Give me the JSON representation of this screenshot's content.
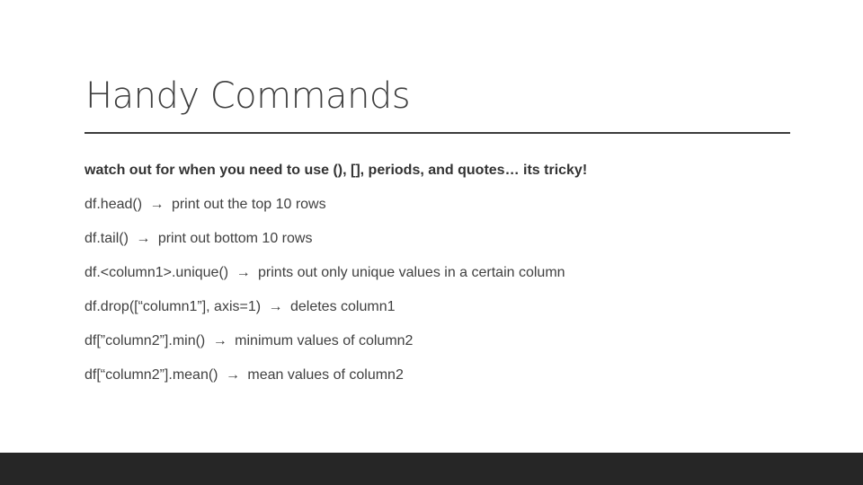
{
  "slide": {
    "title": "Handy Commands",
    "note": "watch out for when you need to use (), [], periods, and quotes… its tricky!",
    "commands": [
      {
        "code": "df.head()",
        "arrow": "→",
        "description": "print out the top 10 rows"
      },
      {
        "code": "df.tail()",
        "arrow": "→",
        "description": "print out bottom 10 rows"
      },
      {
        "code": "df.<column1>.unique()",
        "arrow": "→",
        "description": "prints out only unique values in a certain column"
      },
      {
        "code": "df.drop([“column1”], axis=1)",
        "arrow": "→",
        "description": "deletes column1"
      },
      {
        "code": "df[”column2”].min()",
        "arrow": "→",
        "description": "minimum values of column2"
      },
      {
        "code": "df[“column2”].mean()",
        "arrow": "→",
        "description": "mean values of column2"
      }
    ]
  },
  "colors": {
    "text": "#404040",
    "rule": "#3c3c3c",
    "footer": "#262626",
    "background": "#ffffff"
  }
}
